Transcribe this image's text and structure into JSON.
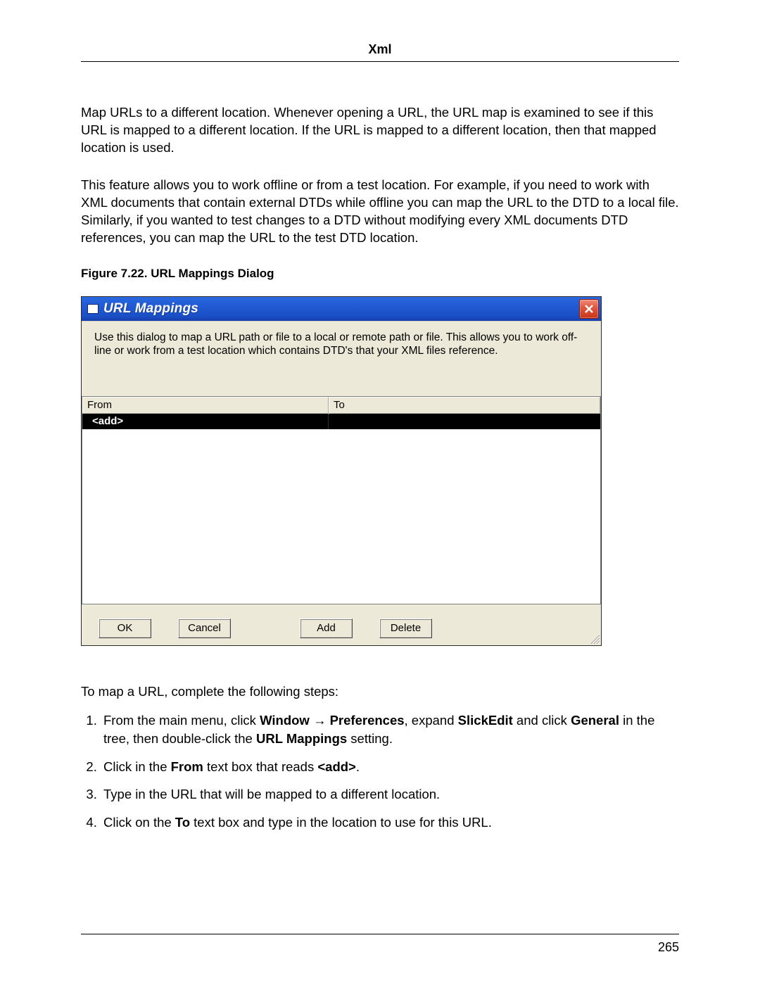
{
  "header": {
    "title": "Xml"
  },
  "intro": {
    "p1": "Map URLs to a different location. Whenever opening a URL, the URL map is examined to see if this URL is mapped to a different location. If the URL is mapped to a different location, then that mapped location is used.",
    "p2": "This feature allows you to work offline or from a test location. For example, if you need to work with XML documents that contain external DTDs while offline you can map the URL to the DTD to a local file. Similarly, if you wanted to test changes to a DTD without modifying every XML documents DTD references, you can map the URL to the test DTD location."
  },
  "figure": {
    "caption": "Figure 7.22. URL Mappings Dialog"
  },
  "dialog": {
    "title": "URL Mappings",
    "description": "Use this dialog to map a URL path or file to a local or remote path or file.  This allows you to work off-line or work from a test location which contains DTD's that your XML files reference.",
    "columns": {
      "from": "From",
      "to": "To"
    },
    "rows": [
      {
        "from": "<add>",
        "to": ""
      }
    ],
    "buttons": {
      "ok": "OK",
      "cancel": "Cancel",
      "add": "Add",
      "delete": "Delete"
    }
  },
  "after": {
    "lead": "To map a URL, complete the following steps:",
    "steps": {
      "s1_a": "From the main menu, click ",
      "s1_b_bold": "Window",
      "s1_arrow": " → ",
      "s1_c_bold": "Preferences",
      "s1_d": ", expand ",
      "s1_e_bold": "SlickEdit",
      "s1_f": " and click ",
      "s1_g_bold": "General",
      "s1_h": " in the tree, then double-click the ",
      "s1_i_bold": "URL Mappings",
      "s1_j": " setting.",
      "s2_a": "Click in the ",
      "s2_b_bold": "From",
      "s2_c": " text box that reads ",
      "s2_d_bold": "<add>",
      "s2_e": ".",
      "s3": "Type in the URL that will be mapped to a different location.",
      "s4_a": "Click on the ",
      "s4_b_bold": "To",
      "s4_c": " text box and type in the location to use for this URL."
    }
  },
  "footer": {
    "page": "265"
  }
}
